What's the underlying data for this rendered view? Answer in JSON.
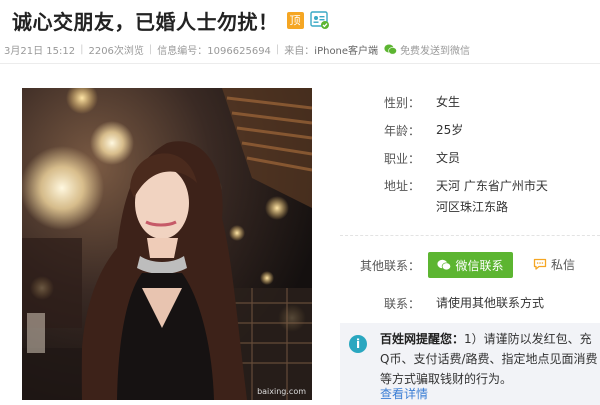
{
  "header": {
    "title": "诚心交朋友，已婚人士勿扰！",
    "top_badge": "顶",
    "verify_icon": "verified-id-icon"
  },
  "meta": {
    "date": "3月21日 15:12",
    "views": "2206次浏览",
    "info_id": "信息编号：1096625694",
    "source_label": "来自：",
    "source": "iPhone客户端",
    "wechat_icon": "wechat-icon",
    "send_wechat": "免费发送到微信"
  },
  "profile": {
    "gender_label": "性别：",
    "gender": "女生",
    "age_label": "年龄：",
    "age": "25岁",
    "job_label": "职业：",
    "job": "文员",
    "address_label": "地址：",
    "address": "天河 广东省广州市天河区珠江东路"
  },
  "contact": {
    "other_label": "其他联系：",
    "wechat_button": "微信联系",
    "private_msg": "私信",
    "contact_label": "联系：",
    "contact_text": "请使用其他联系方式"
  },
  "tip": {
    "brand": "百姓网提醒您：",
    "text": "1）请谨防以发红包、充Q币、支付话费/路费、指定地点见面消费等方式骗取钱财的行为。",
    "more": "查看详情"
  },
  "photo": {
    "watermark": "baixing.com"
  },
  "colors": {
    "accent_green": "#5cb531",
    "badge_orange": "#f5a623",
    "link_blue": "#3b7ed4",
    "tip_bg": "#f2f3f7"
  }
}
